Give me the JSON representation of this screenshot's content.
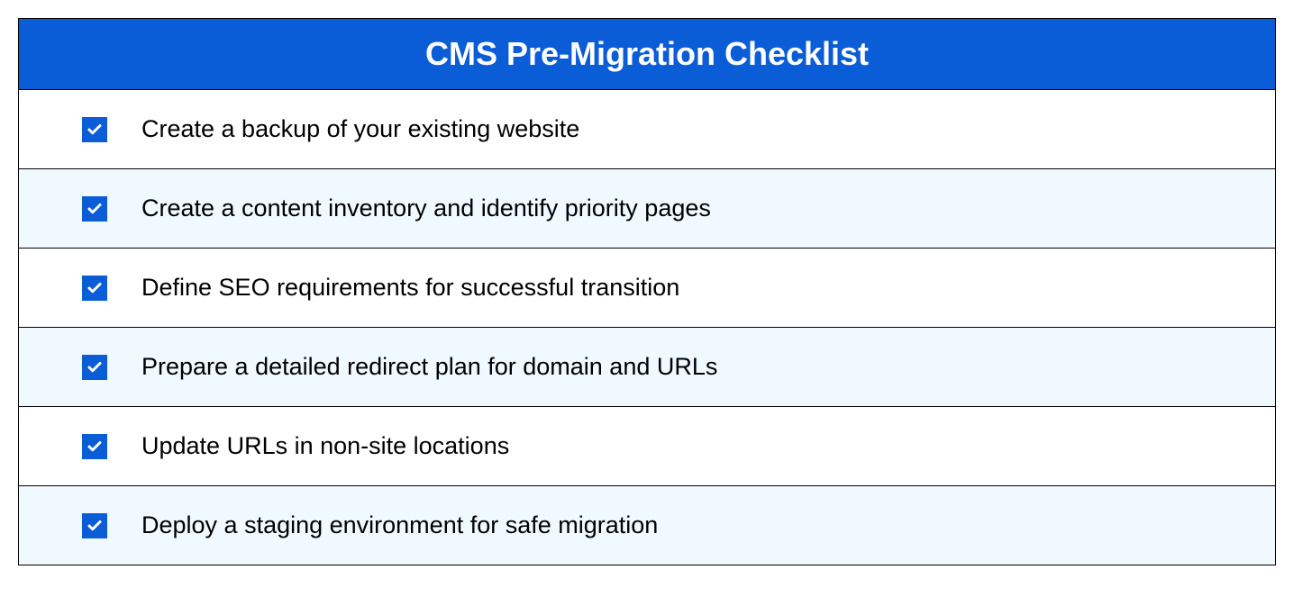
{
  "title": "CMS Pre-Migration Checklist",
  "items": [
    {
      "label": "Create a backup of your existing website",
      "checked": true,
      "bg": "white"
    },
    {
      "label": "Create a content inventory and identify priority pages",
      "checked": true,
      "bg": "light"
    },
    {
      "label": "Define SEO requirements for successful transition",
      "checked": true,
      "bg": "white"
    },
    {
      "label": "Prepare a detailed redirect plan for domain and URLs",
      "checked": true,
      "bg": "light"
    },
    {
      "label": "Update URLs in non-site locations",
      "checked": true,
      "bg": "white"
    },
    {
      "label": "Deploy a staging environment for safe migration",
      "checked": true,
      "bg": "light"
    }
  ]
}
